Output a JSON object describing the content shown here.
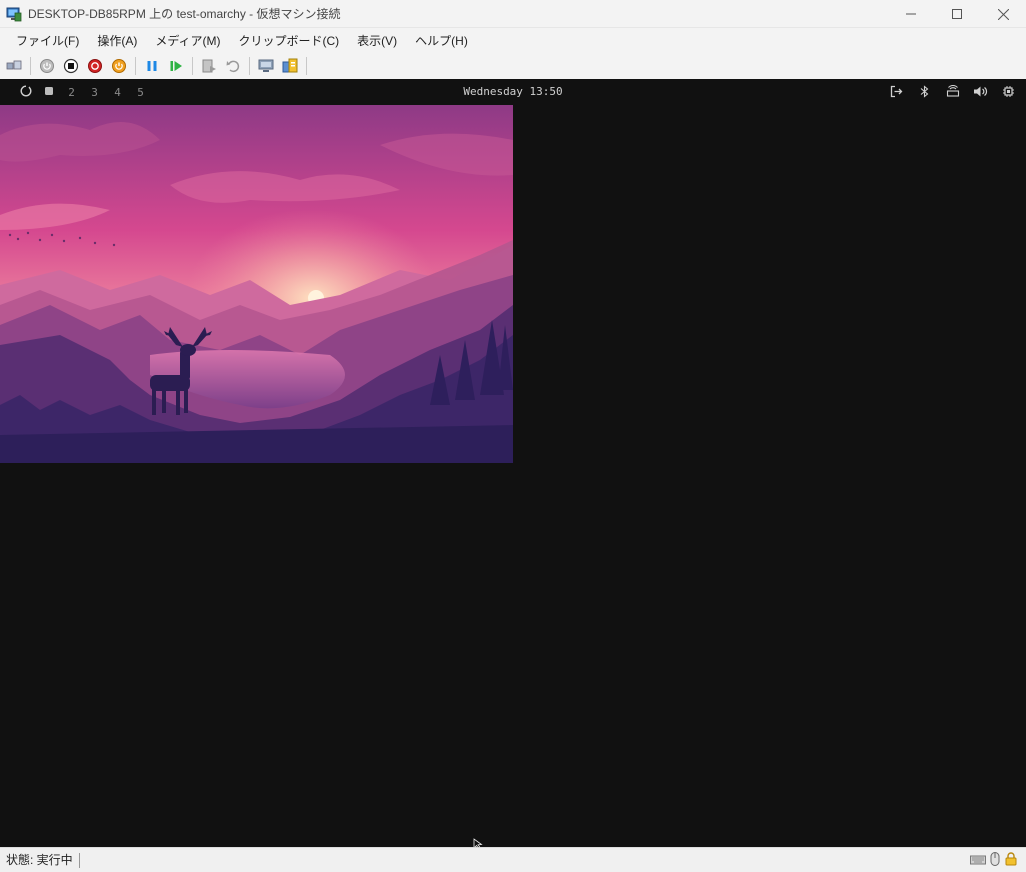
{
  "window": {
    "title": "DESKTOP-DB85RPM 上の test-omarchy  - 仮想マシン接続",
    "minimize_glyph": "─",
    "maximize_glyph": "☐",
    "close_glyph": "✕"
  },
  "menu": {
    "items": [
      "ファイル(F)",
      "操作(A)",
      "メディア(M)",
      "クリップボード(C)",
      "表示(V)",
      "ヘルプ(H)"
    ]
  },
  "toolbar": {
    "icons": [
      "ctrl-alt-del-icon",
      "start-icon",
      "turn-off-icon",
      "shut-down-icon",
      "save-icon",
      "pause-icon",
      "resume-icon",
      "checkpoint-icon",
      "revert-icon",
      "enhanced-session-icon",
      "share-icon"
    ]
  },
  "vm": {
    "waybar": {
      "workspaces": [
        "2",
        "3",
        "4",
        "5"
      ],
      "clock": "Wednesday 13:50",
      "tray_icons": [
        "logout-icon",
        "bluetooth-icon",
        "network-icon",
        "volume-icon",
        "cpu-icon"
      ]
    },
    "background": "#111111"
  },
  "status": {
    "text": "状態: 実行中",
    "icons": [
      "keyboard-icon",
      "mouse-icon",
      "lock-icon"
    ]
  }
}
